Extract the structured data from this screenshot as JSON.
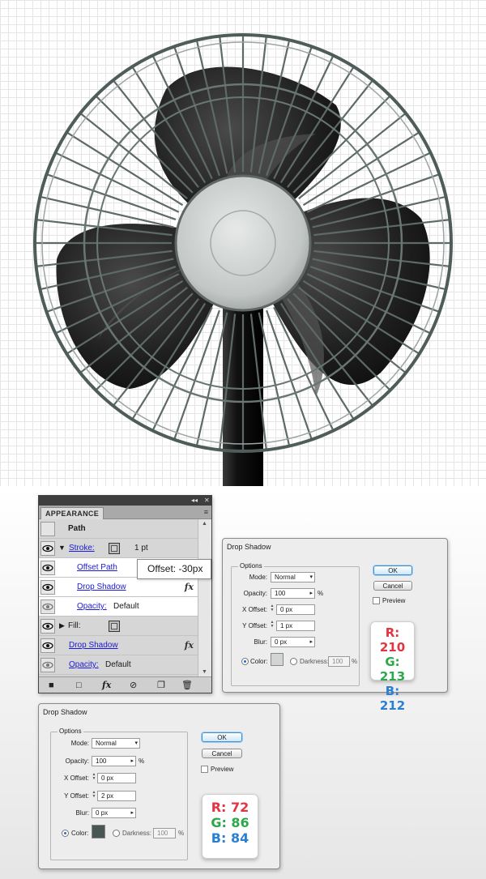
{
  "appearance_panel": {
    "tab_title": "APPEARANCE",
    "topbar_controls": [
      "◂◂",
      "✕"
    ],
    "menu_icon": "≡",
    "rows": {
      "path_label": "Path",
      "stroke_label": "Stroke:",
      "stroke_weight": "1 pt",
      "offset_path_label": "Offset Path",
      "drop_shadow_inner_label": "Drop Shadow",
      "opacity_inner_label": "Opacity:",
      "opacity_inner_value": "Default",
      "fill_label": "Fill:",
      "drop_shadow_label": "Drop Shadow",
      "opacity_label": "Opacity:",
      "opacity_value": "Default",
      "fx_symbol": "fx"
    },
    "offset_tooltip": "Offset: -30px"
  },
  "dialog_1": {
    "title": "Drop Shadow",
    "options_label": "Options",
    "mode_label": "Mode:",
    "mode_value": "Normal",
    "opacity_label": "Opacity:",
    "opacity_value": "100",
    "opacity_unit": "%",
    "x_offset_label": "X Offset:",
    "x_offset_value": "0 px",
    "y_offset_label": "Y Offset:",
    "y_offset_value": "1 px",
    "blur_label": "Blur:",
    "blur_value": "0 px",
    "color_label": "Color:",
    "color_swatch": "#d2d5d4",
    "darkness_label": "Darkness:",
    "darkness_value": "100",
    "darkness_unit": "%",
    "ok_label": "OK",
    "cancel_label": "Cancel",
    "preview_label": "Preview",
    "rgb": {
      "r": "R: 210",
      "g": "G: 213",
      "b": "B: 212"
    }
  },
  "dialog_2": {
    "title": "Drop Shadow",
    "options_label": "Options",
    "mode_label": "Mode:",
    "mode_value": "Normal",
    "opacity_label": "Opacity:",
    "opacity_value": "100",
    "opacity_unit": "%",
    "x_offset_label": "X Offset:",
    "x_offset_value": "0 px",
    "y_offset_label": "Y Offset:",
    "y_offset_value": "2 px",
    "blur_label": "Blur:",
    "blur_value": "0 px",
    "color_label": "Color:",
    "color_swatch": "#485654",
    "darkness_label": "Darkness:",
    "darkness_value": "100",
    "darkness_unit": "%",
    "ok_label": "OK",
    "cancel_label": "Cancel",
    "preview_label": "Preview",
    "rgb": {
      "r": "R: 72",
      "g": "G: 86",
      "b": "B: 84"
    }
  },
  "colors": {
    "grid_line": "#e5e5e5",
    "fan_guard": "#4e5c5a",
    "fan_blade": "#1c1c1c",
    "fan_hub": "#c4c8c6",
    "link_blue": "#1a1ad8"
  }
}
